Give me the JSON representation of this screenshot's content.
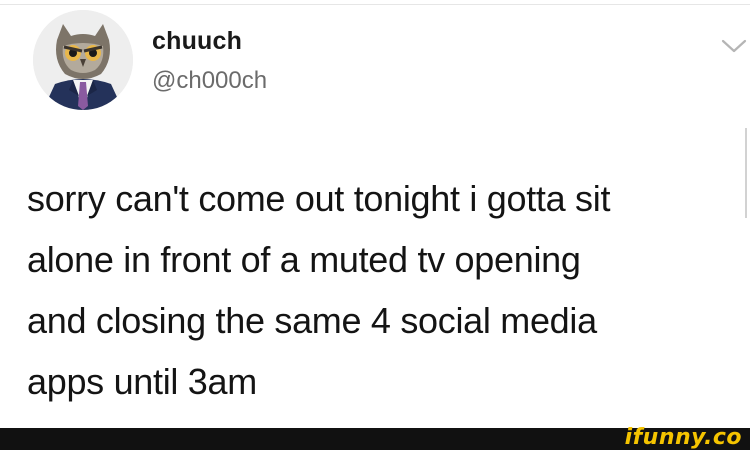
{
  "tweet": {
    "author": {
      "display_name": "chuuch",
      "handle": "@ch000ch",
      "avatar_icon": "owl-in-suit-avatar"
    },
    "menu_icon": "chevron-down-icon",
    "text_lines": [
      "sorry can't come out tonight i gotta sit",
      "alone in front of a muted tv opening",
      "and closing the same 4 social media",
      "apps until 3am"
    ]
  },
  "watermark": {
    "text": "ifunny.co",
    "color": "#f5c400"
  },
  "colors": {
    "background": "#ffffff",
    "text": "#141414",
    "handle": "#6b6b6b",
    "footer": "#111111"
  }
}
